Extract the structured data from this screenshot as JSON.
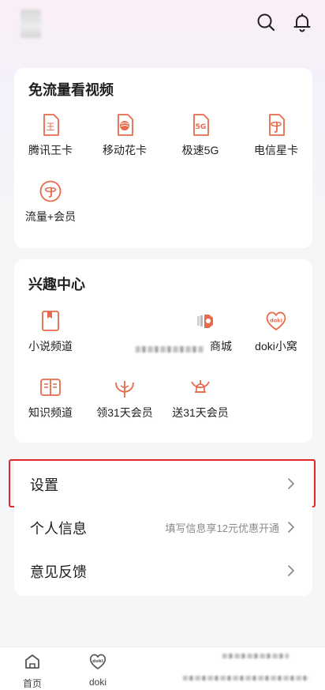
{
  "colors": {
    "accent": "#e8694b",
    "highlight": "#e0262b"
  },
  "free_video": {
    "title": "免流量看视频",
    "items": [
      {
        "label": "腾讯王卡",
        "icon": "wang-card-icon"
      },
      {
        "label": "移动花卡",
        "icon": "mobile-flower-card-icon"
      },
      {
        "label": "极速5G",
        "icon": "5g-card-icon"
      },
      {
        "label": "电信星卡",
        "icon": "telecom-star-card-icon"
      },
      {
        "label": "流量+会员",
        "icon": "data-plus-vip-icon"
      }
    ]
  },
  "interest": {
    "title": "兴趣中心",
    "items": [
      {
        "label": "小说频道",
        "icon": "novel-icon"
      },
      {
        "label": "商城",
        "icon": "mall-icon"
      },
      {
        "label": "doki小窝",
        "icon": "doki-heart-icon"
      },
      {
        "label": "知识频道",
        "icon": "knowledge-book-icon"
      },
      {
        "label": "领31天会员",
        "icon": "gift-vip-icon"
      },
      {
        "label": "送31天会员",
        "icon": "bell-gift-icon"
      }
    ]
  },
  "menu": {
    "settings": "设置",
    "profile": "个人信息",
    "profile_hint": "填写信息享12元优惠开通",
    "feedback": "意见反馈"
  },
  "bottom_nav": {
    "home": "首页",
    "doki": "doki"
  }
}
